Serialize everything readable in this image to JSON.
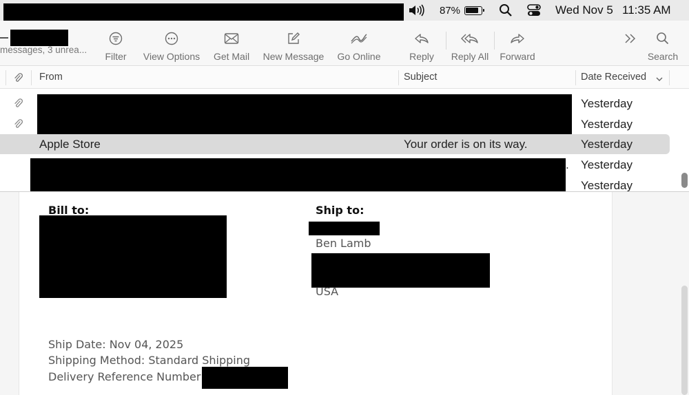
{
  "menubar": {
    "battery_percent": "87%",
    "date": "Wed Nov 5",
    "time": "11:35 AM"
  },
  "toolbar": {
    "mailbox_subtitle": "messages, 3 unrea...",
    "filter": "Filter",
    "view_options": "View Options",
    "get_mail": "Get Mail",
    "new_message": "New Message",
    "go_online": "Go Online",
    "reply": "Reply",
    "reply_all": "Reply All",
    "forward": "Forward",
    "search": "Search"
  },
  "columns": {
    "from": "From",
    "subject": "Subject",
    "date_received": "Date Received"
  },
  "messages": [
    {
      "from": "",
      "subject": "",
      "date": "Yesterday",
      "has_attachment": true
    },
    {
      "from": "",
      "subject": "",
      "date": "Yesterday",
      "has_attachment": true
    },
    {
      "from": "Apple Store",
      "subject": "Your order is on its way.",
      "date": "Yesterday",
      "has_attachment": false,
      "selected": true
    },
    {
      "from": "",
      "subject": "",
      "date": "Yesterday",
      "has_attachment": false
    },
    {
      "from": "",
      "subject": "",
      "date": "Yesterday",
      "has_attachment": false
    }
  ],
  "preview": {
    "bill_to_label": "Bill to:",
    "ship_to_label": "Ship to:",
    "ship_name": "Ben Lamb",
    "ship_country": "USA",
    "ship_date": "Ship Date: Nov 04, 2025",
    "shipping_method": "Shipping Method: Standard Shipping",
    "delivery_ref_label": "Delivery Reference Number:"
  },
  "colors": {
    "selected_row": "#dadada",
    "redaction": "#000000",
    "toolbar_icon": "#6e6e6e"
  }
}
